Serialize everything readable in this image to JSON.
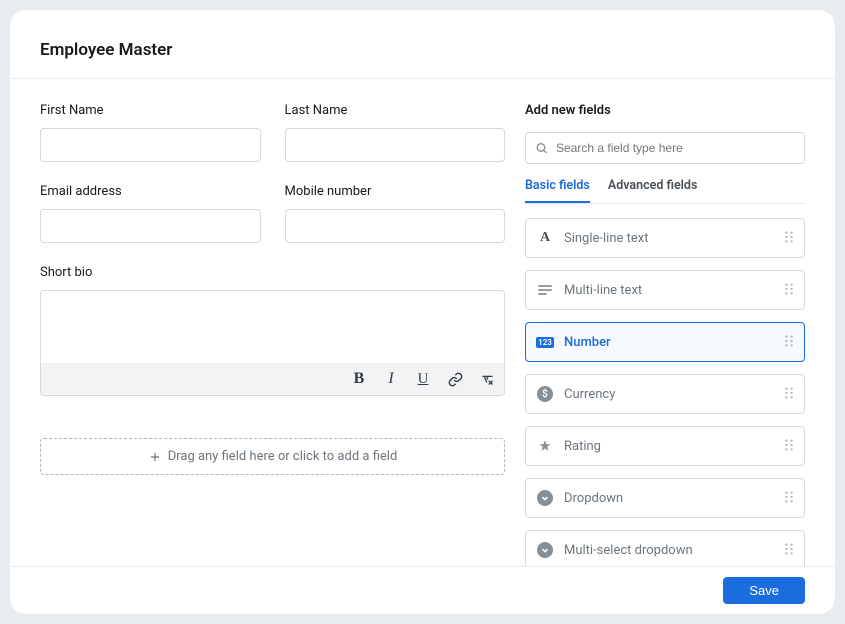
{
  "header": {
    "title": "Employee Master"
  },
  "form": {
    "fields": {
      "first_name": {
        "label": "First Name",
        "value": ""
      },
      "last_name": {
        "label": "Last Name",
        "value": ""
      },
      "email": {
        "label": "Email address",
        "value": ""
      },
      "mobile": {
        "label": "Mobile number",
        "value": ""
      },
      "bio": {
        "label": "Short bio",
        "value": ""
      }
    },
    "dropzone_text": "Drag any field here or click to add a field"
  },
  "sidebar": {
    "title": "Add new fields",
    "search_placeholder": "Search a field type here",
    "tabs": {
      "basic": "Basic fields",
      "advanced": "Advanced fields"
    },
    "field_types": [
      {
        "label": "Single-line text",
        "icon": "text",
        "selected": false
      },
      {
        "label": "Multi-line text",
        "icon": "multiline",
        "selected": false
      },
      {
        "label": "Number",
        "icon": "number",
        "selected": true
      },
      {
        "label": "Currency",
        "icon": "currency",
        "selected": false
      },
      {
        "label": "Rating",
        "icon": "rating",
        "selected": false
      },
      {
        "label": "Dropdown",
        "icon": "dropdown",
        "selected": false
      },
      {
        "label": "Multi-select dropdown",
        "icon": "dropdown",
        "selected": false
      }
    ]
  },
  "footer": {
    "save_label": "Save"
  }
}
